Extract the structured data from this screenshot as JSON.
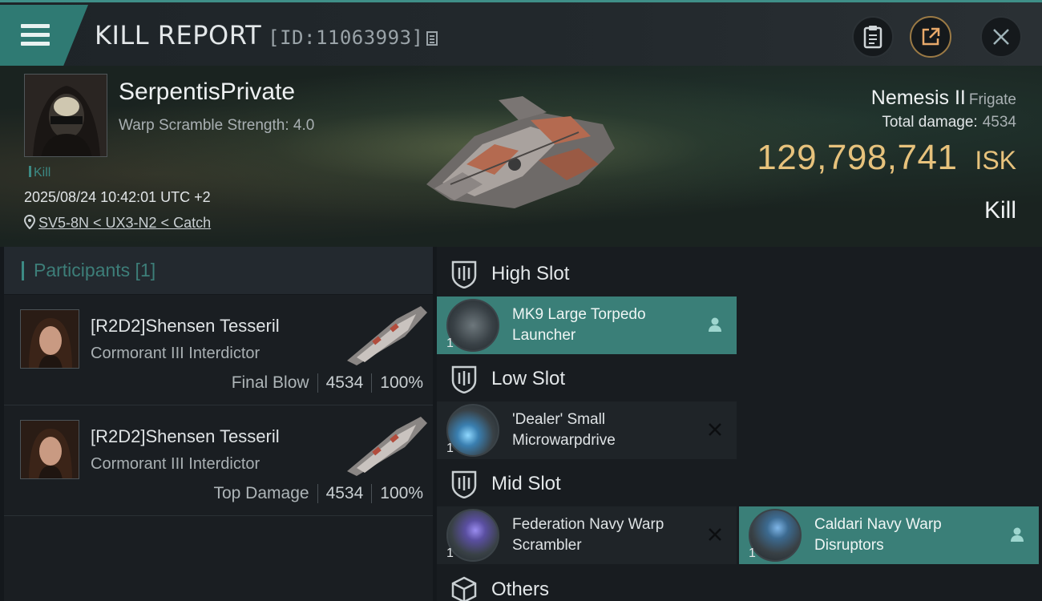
{
  "header": {
    "title": "KILL REPORT",
    "report_id": "[ID:11063993]"
  },
  "victim": {
    "name": "SerpentisPrivate",
    "scramble_strength": "Warp Scramble Strength: 4.0",
    "tag": "Kill",
    "datetime": "2025/08/24 10:42:01 UTC +2",
    "location": "SV5-8N < UX3-N2 < Catch"
  },
  "ship": {
    "name": "Nemesis II",
    "class": "Frigate",
    "total_damage_label": "Total damage:",
    "total_damage_value": "4534",
    "isk_value": "129,798,741",
    "isk_unit": "ISK",
    "result": "Kill"
  },
  "participants": {
    "title": "Participants [1]",
    "rows": [
      {
        "name": "[R2D2]Shensen Tesseril",
        "ship": "Cormorant III Interdictor",
        "label": "Final Blow",
        "damage": "4534",
        "percent": "100%"
      },
      {
        "name": "[R2D2]Shensen Tesseril",
        "ship": "Cormorant III Interdictor",
        "label": "Top Damage",
        "damage": "4534",
        "percent": "100%"
      }
    ]
  },
  "fitting": {
    "high_slot": {
      "title": "High Slot",
      "modules": [
        {
          "name": "MK9 Large Torpedo Launcher",
          "qty": "1",
          "status": "fitted"
        }
      ]
    },
    "low_slot": {
      "title": "Low Slot",
      "modules": [
        {
          "name": "'Dealer' Small Microwarpdrive",
          "qty": "1",
          "status": "destroyed"
        }
      ]
    },
    "mid_slot": {
      "title": "Mid Slot",
      "modules": [
        {
          "name": "Federation Navy Warp Scrambler",
          "qty": "1",
          "status": "destroyed"
        },
        {
          "name": "Caldari Navy Warp Disruptors",
          "qty": "1",
          "status": "fitted"
        }
      ]
    },
    "others": {
      "title": "Others"
    }
  },
  "colors": {
    "accent": "#3a7f78",
    "isk": "#e7c27c",
    "share_ring": "#9b7a45"
  }
}
